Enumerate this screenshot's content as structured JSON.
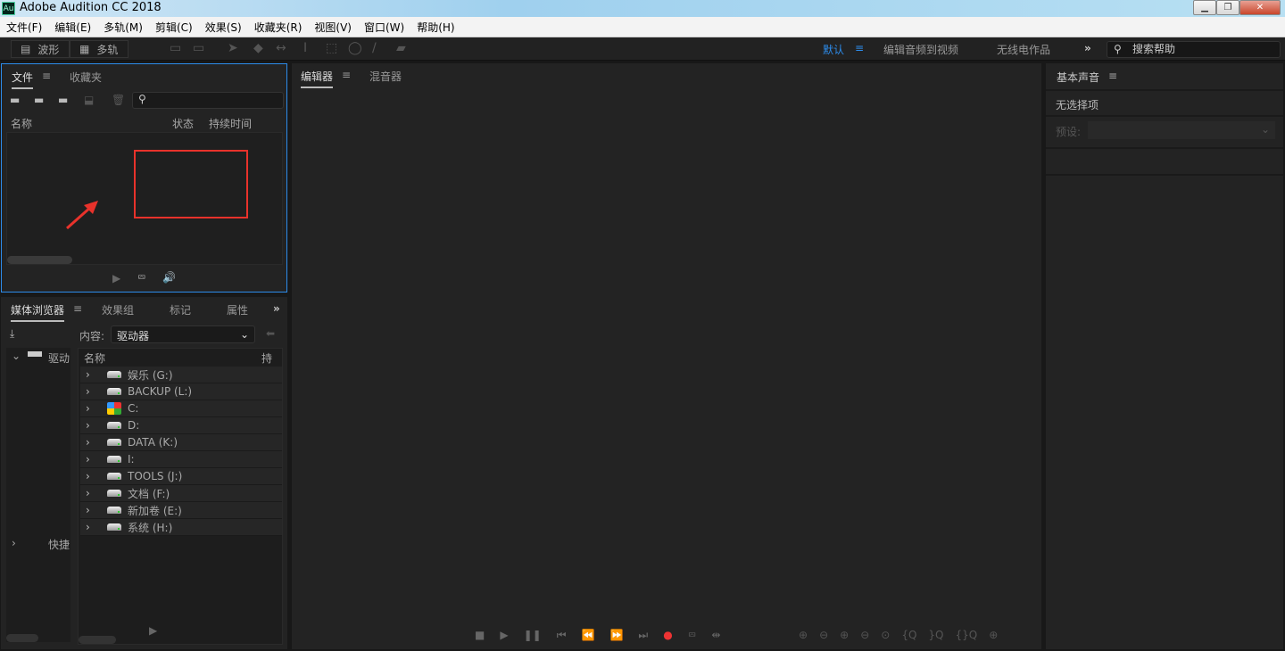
{
  "window": {
    "title": "Adobe Audition CC 2018",
    "logo": "Au",
    "controls": [
      "minimize",
      "restore",
      "close"
    ]
  },
  "menu": [
    "文件(F)",
    "编辑(E)",
    "多轨(M)",
    "剪辑(C)",
    "效果(S)",
    "收藏夹(R)",
    "视图(V)",
    "窗口(W)",
    "帮助(H)"
  ],
  "toolbar": {
    "waveform": "波形",
    "multitrack": "多轨",
    "workspaces": [
      "默认",
      "编辑音频到视频",
      "无线电作品"
    ],
    "active_workspace": "默认",
    "search_placeholder": "搜索帮助",
    "accent": "#2d8ceb"
  },
  "files_panel": {
    "tabs": [
      "文件",
      "收藏夹"
    ],
    "columns": [
      "名称",
      "状态",
      "持续时间"
    ]
  },
  "media_panel": {
    "tabs": [
      "媒体浏览器",
      "效果组",
      "标记",
      "属性"
    ],
    "content_label": "内容:",
    "content_value": "驱动器",
    "name_col": "名称",
    "dur_col": "持续",
    "tree": [
      "驱动",
      "快捷"
    ],
    "drives": [
      {
        "label": "娱乐 (G:)",
        "icon": "drive"
      },
      {
        "label": "BACKUP (L:)",
        "icon": "drive"
      },
      {
        "label": "C:",
        "icon": "windows-drive"
      },
      {
        "label": "D:",
        "icon": "drive"
      },
      {
        "label": "DATA (K:)",
        "icon": "drive"
      },
      {
        "label": "I:",
        "icon": "drive"
      },
      {
        "label": "TOOLS (J:)",
        "icon": "drive"
      },
      {
        "label": "文档 (F:)",
        "icon": "drive"
      },
      {
        "label": "新加卷 (E:)",
        "icon": "drive"
      },
      {
        "label": "系统 (H:)",
        "icon": "drive"
      }
    ]
  },
  "editor": {
    "tabs": [
      "编辑器",
      "混音器"
    ]
  },
  "essential_sound": {
    "title": "基本声音",
    "no_selection": "无选择项",
    "preset_label": "预设:"
  },
  "annotation": {
    "color": "#e8322b"
  }
}
